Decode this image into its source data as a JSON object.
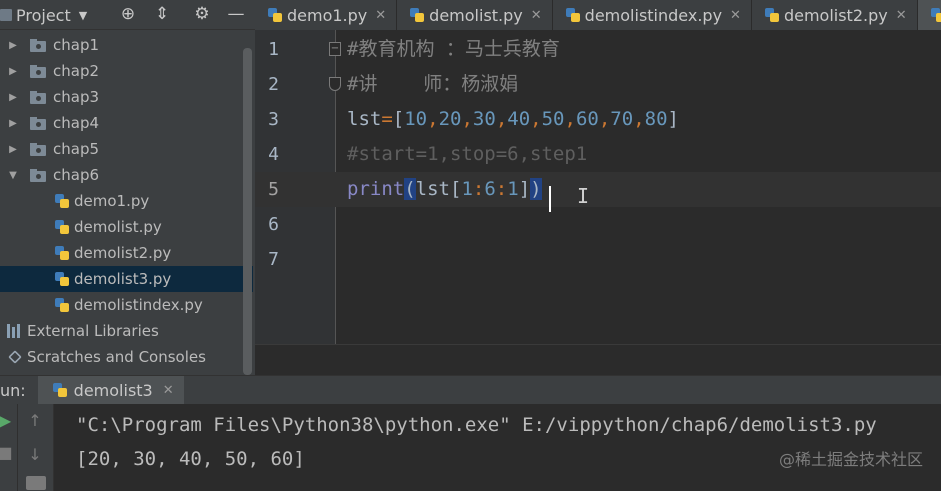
{
  "project_panel": {
    "title": "Project",
    "toolbar_icons": [
      "locate-icon",
      "collapse-icon",
      "gear-icon",
      "minimize-icon"
    ]
  },
  "tabs": [
    {
      "label": "demo1.py",
      "active": false
    },
    {
      "label": "demolist.py",
      "active": false
    },
    {
      "label": "demolistindex.py",
      "active": false
    },
    {
      "label": "demolist2.py",
      "active": false
    },
    {
      "label": "de",
      "active": true
    }
  ],
  "tree": {
    "folders": [
      "chap1",
      "chap2",
      "chap3",
      "chap4",
      "chap5"
    ],
    "open_folder": "chap6",
    "files": [
      "demo1.py",
      "demolist.py",
      "demolist2.py",
      "demolist3.py",
      "demolistindex.py"
    ],
    "selected_file": "demolist3.py",
    "external_libraries": "External Libraries",
    "scratches": "Scratches and Consoles"
  },
  "editor": {
    "line_numbers": [
      "1",
      "2",
      "3",
      "4",
      "5",
      "6",
      "7"
    ],
    "current_line": "5",
    "lines": {
      "l1": "#教育机构 ：马士兵教育",
      "l2": "#讲    师：杨淑娟",
      "l3": {
        "name": "lst",
        "eq": "=",
        "open": "[",
        "close": "]",
        "nums": [
          "10",
          "20",
          "30",
          "40",
          "50",
          "60",
          "70",
          "80"
        ],
        "comma": ","
      },
      "l4": "#start=1,stop=6,step1",
      "l5": {
        "fn": "print",
        "lp": "(",
        "var": "lst",
        "lb": "[",
        "a": "1",
        "colon": ":",
        "b": "6",
        "c": "1",
        "rb": "]",
        "rp": ")"
      }
    }
  },
  "run": {
    "label": "un:",
    "tab": "demolist3",
    "output": [
      "\"C:\\Program Files\\Python38\\python.exe\" E:/vippython/chap6/demolist3.py",
      "[20, 30, 40, 50, 60]"
    ]
  },
  "watermark": "@稀土掘金技术社区",
  "colors": {
    "keyword_op": "#cc7832",
    "number": "#6897bb",
    "builtin": "#8888c6",
    "comment": "#808080",
    "selection": "#0d293e"
  }
}
